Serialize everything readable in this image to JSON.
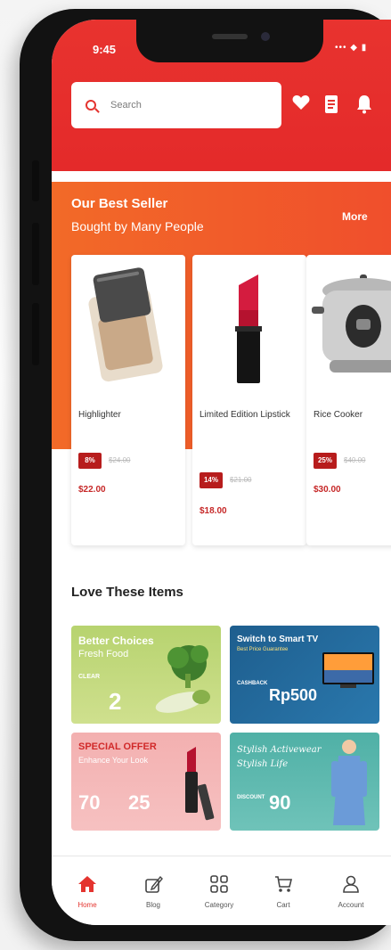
{
  "status_bar": {
    "time": "9:45",
    "signal": "••• ◆ ▮"
  },
  "search": {
    "placeholder": "Search"
  },
  "header_icons": [
    "heart-icon",
    "receipt-icon",
    "bell-icon"
  ],
  "best_seller": {
    "title": "Our Best Seller",
    "subtitle": "Bought by Many People",
    "more": "More",
    "products": [
      {
        "name": "Highlighter",
        "discount": "8%",
        "old_price": "$24.00",
        "price": "$22.00"
      },
      {
        "name": "Limited Edition Lipstick",
        "discount": "14%",
        "old_price": "$21.00",
        "price": "$18.00"
      },
      {
        "name": "Rice Cooker",
        "discount": "25%",
        "old_price": "$40.00",
        "price": "$30.00"
      }
    ]
  },
  "love_items": {
    "title": "Love These Items",
    "promos": [
      {
        "line1": "Better Choices",
        "line2": "Fresh Food",
        "tag": "CLEAR",
        "amount": "2"
      },
      {
        "line1": "Switch to Smart TV",
        "line2": "Best Price Guarantee",
        "tag": "CASHBACK",
        "amount": "Rp500"
      },
      {
        "line1": "SPECIAL OFFER",
        "line2": "Enhance Your Look",
        "amount_a": "70",
        "amount_b": "25"
      },
      {
        "line1": "Stylish Activewear",
        "line2": "Stylish Life",
        "tag": "DISCOUNT",
        "amount": "90"
      }
    ]
  },
  "tabbar": {
    "items": [
      {
        "label": "Home",
        "icon": "home-icon",
        "active": true
      },
      {
        "label": "Blog",
        "icon": "blog-icon",
        "active": false
      },
      {
        "label": "Category",
        "icon": "category-icon",
        "active": false
      },
      {
        "label": "Cart",
        "icon": "cart-icon",
        "active": false
      },
      {
        "label": "Account",
        "icon": "account-icon",
        "active": false
      }
    ]
  },
  "colors": {
    "brand_red": "#e4342f",
    "orange": "#f26a28",
    "price_red": "#c62828"
  }
}
